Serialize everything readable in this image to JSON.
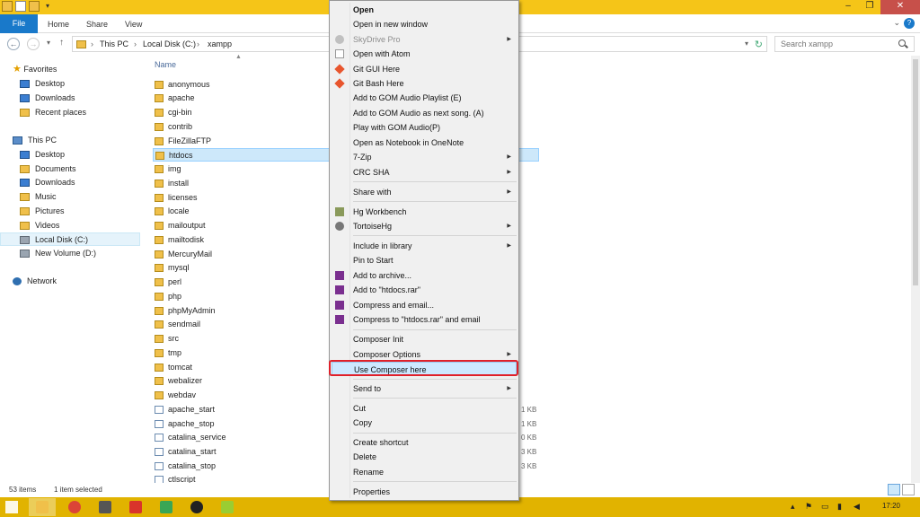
{
  "ribbon": {
    "file": "File",
    "home": "Home",
    "share": "Share",
    "view": "View"
  },
  "address": {
    "path": [
      "This PC",
      "Local Disk (C:)",
      "xampp"
    ],
    "search_placeholder": "Search xampp"
  },
  "nav": {
    "favorites": "Favorites",
    "fav_items": [
      "Desktop",
      "Downloads",
      "Recent places"
    ],
    "thispc": "This PC",
    "pc_items": [
      "Desktop",
      "Documents",
      "Downloads",
      "Music",
      "Pictures",
      "Videos",
      "Local Disk (C:)",
      "New Volume (D:)"
    ],
    "network": "Network"
  },
  "list": {
    "column_name": "Name",
    "folders": [
      "anonymous",
      "apache",
      "cgi-bin",
      "contrib",
      "FileZillaFTP",
      "htdocs",
      "img",
      "install",
      "licenses",
      "locale",
      "mailoutput",
      "mailtodisk",
      "MercuryMail",
      "mysql",
      "perl",
      "php",
      "phpMyAdmin",
      "sendmail",
      "src",
      "tmp",
      "tomcat",
      "webalizer",
      "webdav"
    ],
    "files": [
      {
        "name": "apache_start",
        "size": "1 KB"
      },
      {
        "name": "apache_stop",
        "size": "1 KB"
      },
      {
        "name": "catalina_service",
        "size": "0 KB"
      },
      {
        "name": "catalina_start",
        "size": "3 KB"
      },
      {
        "name": "catalina_stop",
        "size": "3 KB"
      },
      {
        "name": "ctlscript",
        "size": ""
      }
    ]
  },
  "status": {
    "items": "53 items",
    "selected": "1 item selected"
  },
  "taskbar": {
    "time": "17:20"
  },
  "menu": {
    "items": [
      {
        "label": "Open",
        "bold": true
      },
      {
        "label": "Open in new window"
      },
      {
        "label": "SkyDrive Pro",
        "disabled": true,
        "sub": true
      },
      {
        "label": "Open with Atom"
      },
      {
        "label": "Git GUI Here"
      },
      {
        "label": "Git Bash Here"
      },
      {
        "label": "Add to GOM Audio Playlist (E)"
      },
      {
        "label": "Add to GOM Audio as next song. (A)"
      },
      {
        "label": "Play with GOM Audio(P)"
      },
      {
        "label": "Open as Notebook in OneNote"
      },
      {
        "label": "7-Zip",
        "sub": true
      },
      {
        "label": "CRC SHA",
        "sub": true
      },
      {
        "label": "Share with",
        "sub": true
      },
      {
        "label": "Hg Workbench"
      },
      {
        "label": "TortoiseHg",
        "sub": true
      },
      {
        "label": "Include in library",
        "sub": true
      },
      {
        "label": "Pin to Start"
      },
      {
        "label": "Add to archive..."
      },
      {
        "label": "Add to \"htdocs.rar\""
      },
      {
        "label": "Compress and email..."
      },
      {
        "label": "Compress to \"htdocs.rar\" and email"
      },
      {
        "label": "Composer Init"
      },
      {
        "label": "Composer Options",
        "sub": true
      },
      {
        "label": "Use Composer here",
        "highlight": true
      },
      {
        "label": "Send to",
        "sub": true
      },
      {
        "label": "Cut"
      },
      {
        "label": "Copy"
      },
      {
        "label": "Create shortcut"
      },
      {
        "label": "Delete"
      },
      {
        "label": "Rename"
      },
      {
        "label": "Properties"
      }
    ]
  }
}
